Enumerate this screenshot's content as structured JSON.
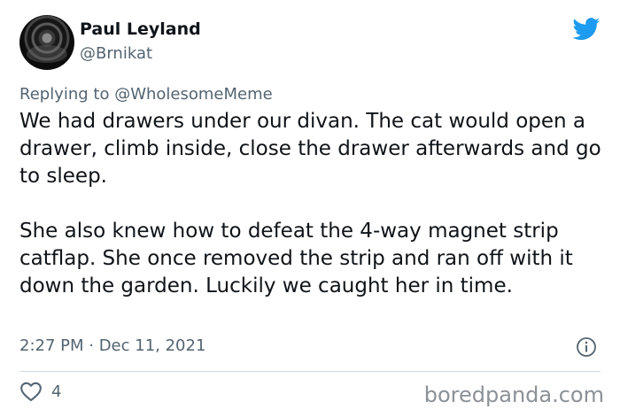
{
  "author": {
    "name": "Paul Leyland",
    "handle": "@Brnikat"
  },
  "reply": {
    "prefix": "Replying to ",
    "mention": "@WholesomeMeme"
  },
  "tweet": {
    "paragraph_1": "We had drawers under our divan. The cat would open a drawer, climb inside, close the drawer afterwards and go to sleep.",
    "paragraph_2": "She also knew how to defeat the 4-way magnet strip catflap. She once removed the strip and ran off with it down the garden. Luckily we caught her in time.",
    "timestamp": "2:27 PM · Dec 11, 2021"
  },
  "stats": {
    "like_count": "4"
  },
  "watermark": "boredpanda.com",
  "icons": {
    "brand": "twitter-bird-icon",
    "info": "info-icon",
    "like": "heart-icon"
  },
  "colors": {
    "brand_blue": "#1d9bf0",
    "text_primary": "#0f1419",
    "text_secondary": "#536471",
    "divider": "#cfd9de"
  }
}
